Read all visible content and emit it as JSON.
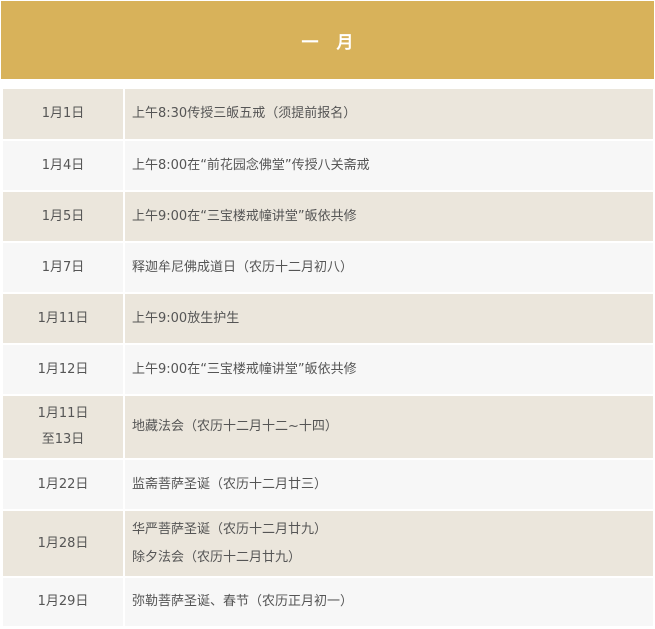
{
  "header": {
    "title": "一 月",
    "background_color": "#d8b25a"
  },
  "schedule": {
    "rows": [
      {
        "date": [
          "1月1日"
        ],
        "events": [
          "上午8:30传授三皈五戒（须提前报名）"
        ]
      },
      {
        "date": [
          "1月4日"
        ],
        "events": [
          "上午8:00在“前花园念佛堂”传授八关斋戒"
        ]
      },
      {
        "date": [
          "1月5日"
        ],
        "events": [
          "上午9:00在“三宝楼戒幢讲堂”皈依共修"
        ]
      },
      {
        "date": [
          "1月7日"
        ],
        "events": [
          "释迦牟尼佛成道日（农历十二月初八）"
        ]
      },
      {
        "date": [
          "1月11日"
        ],
        "events": [
          "上午9:00放生护生"
        ]
      },
      {
        "date": [
          "1月12日"
        ],
        "events": [
          "上午9:00在“三宝楼戒幢讲堂”皈依共修"
        ]
      },
      {
        "date": [
          "1月11日",
          "至13日"
        ],
        "events": [
          "地藏法会（农历十二月十二~十四）"
        ]
      },
      {
        "date": [
          "1月22日"
        ],
        "events": [
          "监斋菩萨圣诞（农历十二月廿三）"
        ]
      },
      {
        "date": [
          "1月28日"
        ],
        "events": [
          "华严菩萨圣诞（农历十二月廿九）",
          "除夕法会（农历十二月廿九）"
        ]
      },
      {
        "date": [
          "1月29日"
        ],
        "events": [
          "弥勒菩萨圣诞、春节（农历正月初一）"
        ]
      }
    ],
    "row_colors": [
      "#ebe6dc",
      "#f7f7f7"
    ]
  }
}
